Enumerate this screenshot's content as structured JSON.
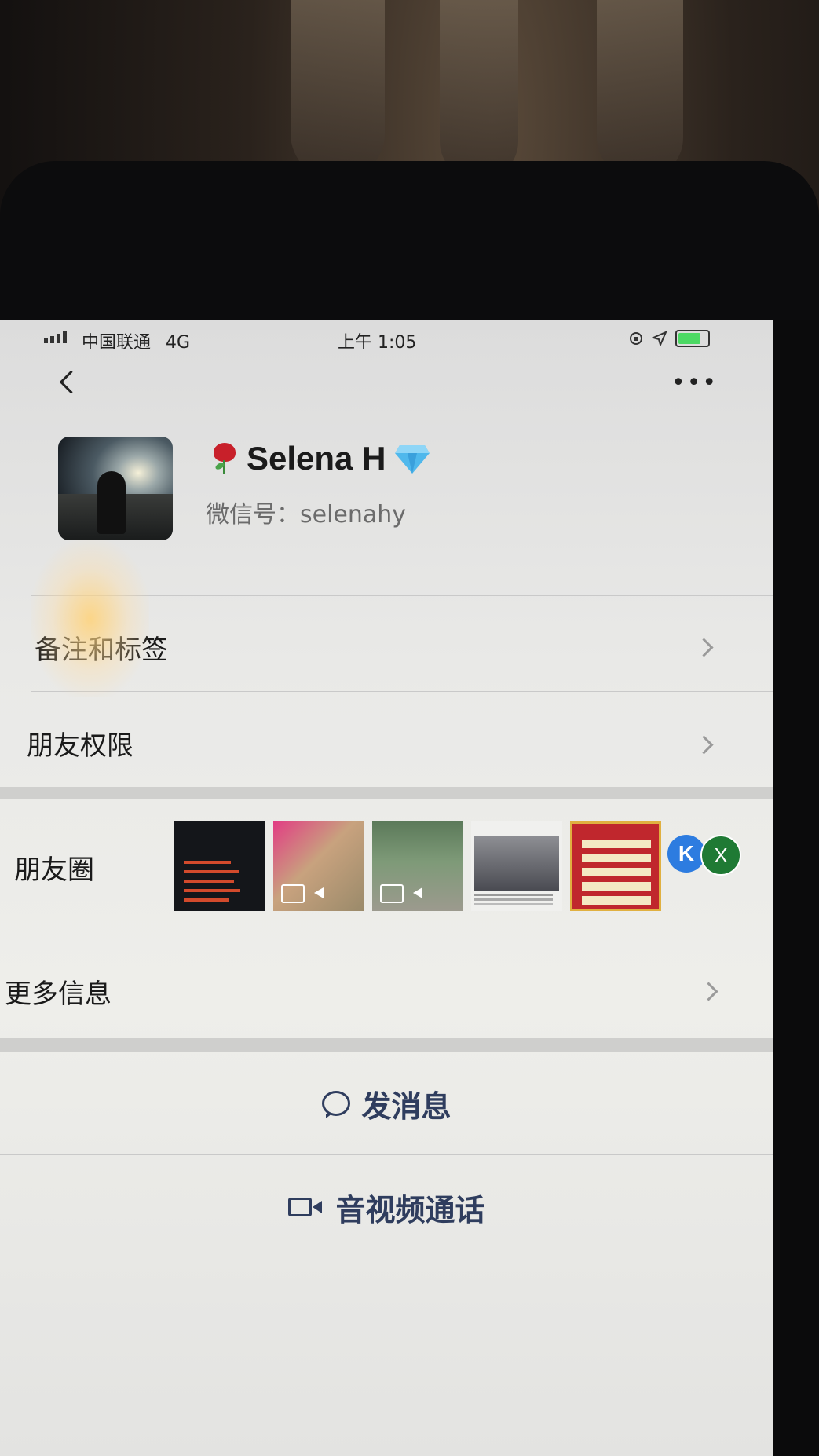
{
  "status_bar": {
    "carrier": "中国联通",
    "network": "4G",
    "time": "上午 1:05"
  },
  "navbar": {
    "back_icon": "chevron-left-icon",
    "more_label": "•••"
  },
  "profile": {
    "name": "Selena H",
    "wechat_id": "微信号：selenahy",
    "name_prefix_icon": "rose-icon",
    "name_suffix_icon": "diamond-icon"
  },
  "rows": {
    "remarks_tags": "备注和标签",
    "friend_permissions": "朋友权限",
    "moments": "朋友圈",
    "more_info": "更多信息"
  },
  "moments_thumbnails": [
    {
      "kind": "text-poster",
      "video": false
    },
    {
      "kind": "hamster-photo",
      "video": true
    },
    {
      "kind": "street-photo",
      "video": true
    },
    {
      "kind": "news-article",
      "video": false
    },
    {
      "kind": "red-poster",
      "video": false
    }
  ],
  "moments_badges": {
    "badge_k": "K",
    "badge_x": "X"
  },
  "actions": {
    "send_message": "发消息",
    "video_call": "音视频通话"
  },
  "colors": {
    "action_text": "#2f3d5e",
    "badge_k": "#2d7ce0",
    "badge_x": "#1f7a34",
    "battery": "#4cd964"
  }
}
